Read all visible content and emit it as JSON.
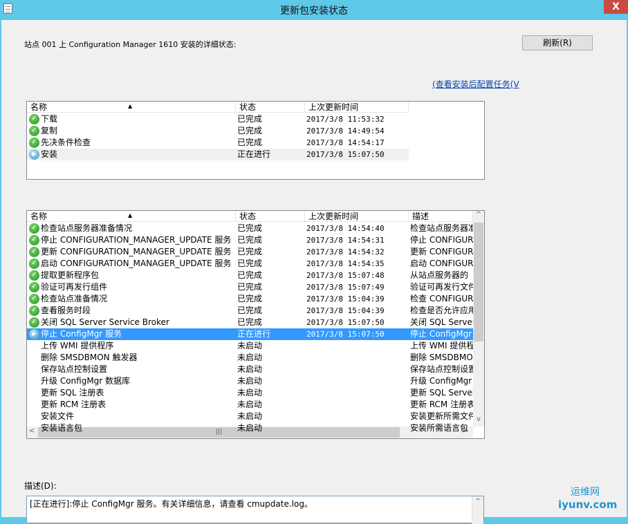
{
  "window": {
    "title": "更新包安装状态",
    "close_label": "X"
  },
  "header": {
    "site_label": "站点 001 上 Configuration Manager 1610  安装的详细状态:",
    "refresh_label": "刷新(R)",
    "view_tasks_link": "(查看安装后配置任务(V"
  },
  "top_list": {
    "columns": [
      "名称",
      "状态",
      "上次更新时间"
    ],
    "rows": [
      {
        "icon": "check-icon",
        "name": "下载",
        "status": "已完成",
        "time": "2017/3/8 11:53:32"
      },
      {
        "icon": "check-icon",
        "name": "复制",
        "status": "已完成",
        "time": "2017/3/8 14:49:54"
      },
      {
        "icon": "check-icon",
        "name": "先决条件检查",
        "status": "已完成",
        "time": "2017/3/8 14:54:17"
      },
      {
        "icon": "in-progress-icon",
        "name": "安装",
        "status": "正在进行",
        "time": "2017/3/8 15:07:50"
      }
    ]
  },
  "bottom_list": {
    "columns": [
      "名称",
      "状态",
      "上次更新时间",
      "描述"
    ],
    "rows": [
      {
        "icon": "check-icon",
        "name": "检查站点服务器准备情况",
        "status": "已完成",
        "time": "2017/3/8 14:54:40",
        "desc": "检查站点服务器准"
      },
      {
        "icon": "check-icon",
        "name": "停止 CONFIGURATION_MANAGER_UPDATE 服务",
        "status": "已完成",
        "time": "2017/3/8 14:54:31",
        "desc": "停止 CONFIGURATI"
      },
      {
        "icon": "check-icon",
        "name": "更新 CONFIGURATION_MANAGER_UPDATE 服务",
        "status": "已完成",
        "time": "2017/3/8 14:54:32",
        "desc": "更新 CONFIGURATI"
      },
      {
        "icon": "check-icon",
        "name": "启动 CONFIGURATION_MANAGER_UPDATE 服务",
        "status": "已完成",
        "time": "2017/3/8 14:54:35",
        "desc": "启动 CONFIGURATI"
      },
      {
        "icon": "check-icon",
        "name": "提取更新程序包",
        "status": "已完成",
        "time": "2017/3/8 15:07:48",
        "desc": "从站点服务器的"
      },
      {
        "icon": "check-icon",
        "name": "验证可再发行组件",
        "status": "已完成",
        "time": "2017/3/8 15:07:49",
        "desc": "验证可再发行文件"
      },
      {
        "icon": "check-icon",
        "name": "检查站点准备情况",
        "status": "已完成",
        "time": "2017/3/8 15:04:39",
        "desc": "检查 CONFIGURATI"
      },
      {
        "icon": "check-icon",
        "name": "查看服务时段",
        "status": "已完成",
        "time": "2017/3/8 15:04:39",
        "desc": "检查是否允许应用"
      },
      {
        "icon": "check-icon",
        "name": "关闭 SQL Server Service Broker",
        "status": "已完成",
        "time": "2017/3/8 15:07:50",
        "desc": "关闭 SQL Server"
      },
      {
        "icon": "in-progress-icon",
        "name": "停止 ConfigMgr 服务",
        "status": "正在进行",
        "time": "2017/3/8 15:07:50",
        "desc": "停止 ConfigMgr",
        "selected": true
      },
      {
        "icon": "",
        "name": "上传 WMI 提供程序",
        "status": "未启动",
        "time": "",
        "desc": "上传 WMI 提供程序"
      },
      {
        "icon": "",
        "name": "删除 SMSDBMON 触发器",
        "status": "未启动",
        "time": "",
        "desc": "删除 SMSDBMON 触"
      },
      {
        "icon": "",
        "name": "保存站点控制设置",
        "status": "未启动",
        "time": "",
        "desc": "保存站点控制设置"
      },
      {
        "icon": "",
        "name": "升级 ConfigMgr 数据库",
        "status": "未启动",
        "time": "",
        "desc": "升级 ConfigMgr"
      },
      {
        "icon": "",
        "name": "更新 SQL 注册表",
        "status": "未启动",
        "time": "",
        "desc": "更新 SQL Server"
      },
      {
        "icon": "",
        "name": "更新 RCM 注册表",
        "status": "未启动",
        "time": "",
        "desc": "更新 RCM 注册表"
      },
      {
        "icon": "",
        "name": "安装文件",
        "status": "未启动",
        "time": "",
        "desc": "安装更新所需文件"
      },
      {
        "icon": "",
        "name": "安装语言包",
        "status": "未启动",
        "time": "",
        "desc": "安装所需语言包"
      }
    ]
  },
  "description": {
    "label": "描述(D):",
    "text": "[正在进行]:停止 ConfigMgr 服务。有关详细信息，请查看 cmupdate.log。"
  },
  "watermark": {
    "line1": "运维网",
    "line2": "iyunv.com"
  }
}
